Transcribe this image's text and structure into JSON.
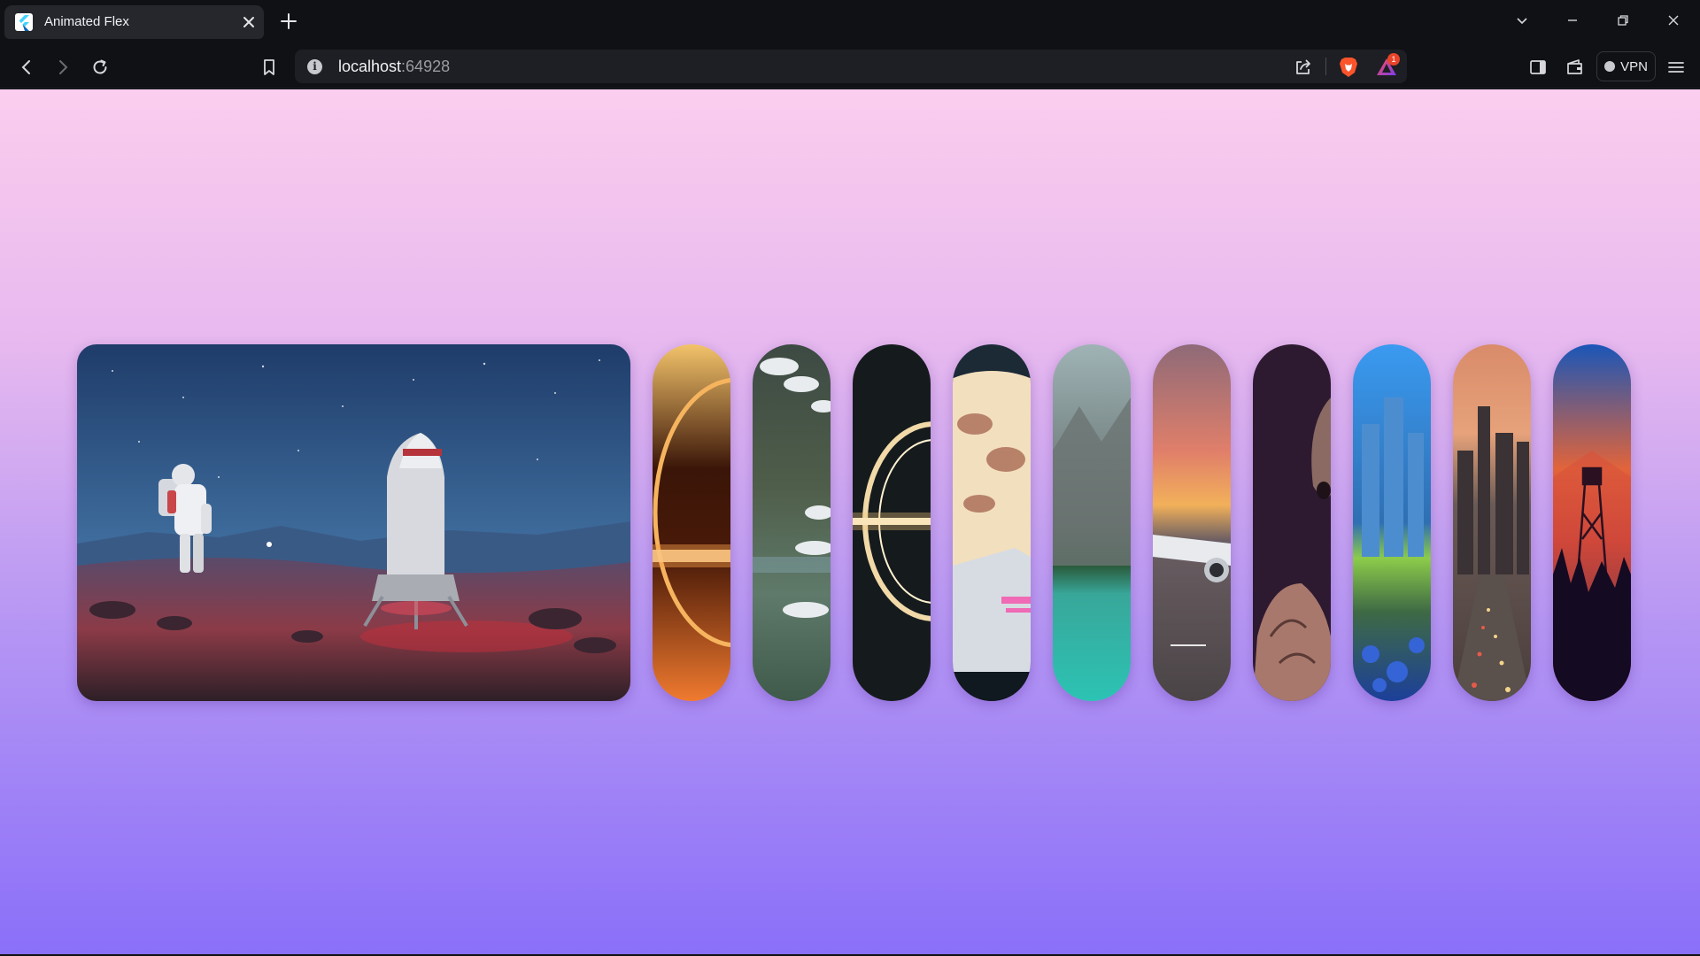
{
  "browser": {
    "tab": {
      "title": "Animated Flex",
      "favicon": "flutter-logo-icon",
      "close_icon": "close-icon"
    },
    "new_tab_icon": "plus-icon",
    "window_controls": [
      "chevron-down-icon",
      "minimize-icon",
      "restore-icon",
      "close-icon"
    ],
    "nav": {
      "back_icon": "back-arrow-icon",
      "forward_icon": "forward-arrow-icon",
      "reload_icon": "reload-icon",
      "bookmark_icon": "bookmark-icon"
    },
    "address": {
      "host": "localhost",
      "port": ":64928",
      "info_icon": "info-icon",
      "share_icon": "share-icon"
    },
    "extensions": {
      "shields_icon": "brave-lion-icon",
      "rewards_icon": "brave-rewards-icon",
      "rewards_badge": "1"
    },
    "right_tools": {
      "sidebar_icon": "sidebar-icon",
      "wallet_icon": "wallet-icon",
      "vpn_label": "VPN",
      "menu_icon": "hamburger-menu-icon"
    }
  },
  "page": {
    "background": {
      "top": "#fbcdee",
      "bottom": "#8a6ff9"
    },
    "gallery": {
      "expanded_index": 0,
      "items": [
        {
          "name": "astronaut-lander",
          "subject": "Astronaut beside a landing capsule on a red planet at night"
        },
        {
          "name": "orange-black-hole",
          "subject": "Orange glowing black hole ring"
        },
        {
          "name": "mountain-valley-clouds",
          "subject": "Aerial mountain valley with clouds"
        },
        {
          "name": "gargantua-black-hole",
          "subject": "White-gold black hole accretion disk"
        },
        {
          "name": "sports-car-moon",
          "subject": "Sports car under a giant moon"
        },
        {
          "name": "turquoise-lake",
          "subject": "Mountain cliffs above a turquoise lake"
        },
        {
          "name": "airplane-sunset",
          "subject": "Airplane on tarmac at sunset"
        },
        {
          "name": "anime-creature",
          "subject": "Dark anime creature silhouette"
        },
        {
          "name": "blue-city-fields",
          "subject": "Blue skyscrapers over green fields and flowers"
        },
        {
          "name": "city-highway",
          "subject": "City skyline and busy highway at dusk"
        },
        {
          "name": "fire-lookout-tower",
          "subject": "Fire lookout tower against an orange sky"
        }
      ]
    }
  }
}
